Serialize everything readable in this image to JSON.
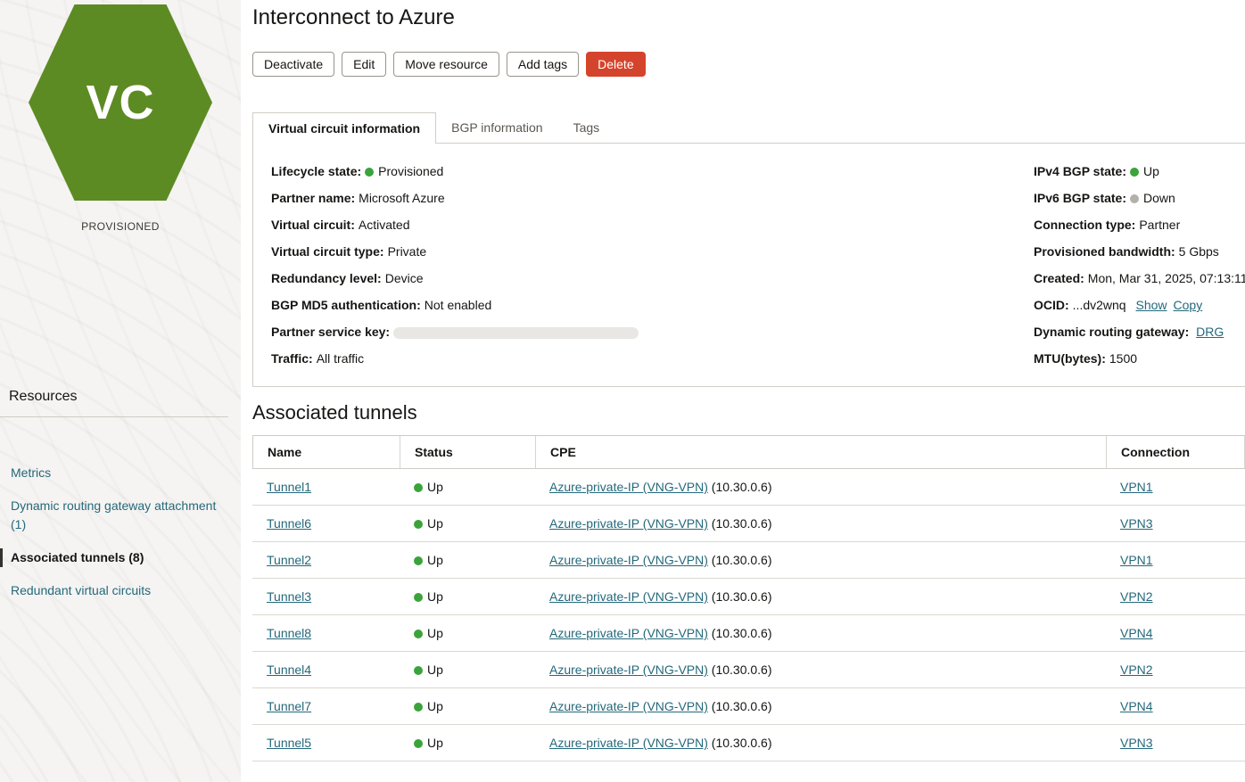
{
  "colors": {
    "link": "#24687b",
    "status_green": "#3ba33b",
    "status_gray": "#b4b0aa",
    "danger_red": "#d4442c",
    "hexagon_green": "#5d8b23"
  },
  "entity": {
    "icon_label": "VC",
    "state_caption": "PROVISIONED"
  },
  "page": {
    "title": "Interconnect to Azure"
  },
  "actions": [
    {
      "label": "Deactivate"
    },
    {
      "label": "Edit"
    },
    {
      "label": "Move resource"
    },
    {
      "label": "Add tags"
    },
    {
      "label": "Delete",
      "danger": true
    }
  ],
  "tabs": [
    {
      "label": "Virtual circuit information",
      "active": true
    },
    {
      "label": "BGP information"
    },
    {
      "label": "Tags"
    }
  ],
  "details": {
    "left": [
      {
        "label": "Lifecycle state:",
        "status": "green",
        "value": "Provisioned"
      },
      {
        "label": "Partner name:",
        "value": "Microsoft Azure"
      },
      {
        "label": "Virtual circuit:",
        "value": "Activated"
      },
      {
        "label": "Virtual circuit type:",
        "value": "Private"
      },
      {
        "label": "Redundancy level:",
        "value": "Device"
      },
      {
        "label": "BGP MD5 authentication:",
        "value": "Not enabled"
      },
      {
        "label": "Partner service key:",
        "redacted": true
      },
      {
        "label": "Traffic:",
        "value": "All traffic"
      }
    ],
    "right": [
      {
        "label": "IPv4 BGP state:",
        "status": "green",
        "value": "Up"
      },
      {
        "label": "IPv6 BGP state:",
        "status": "gray",
        "value": "Down"
      },
      {
        "label": "Connection type:",
        "value": "Partner"
      },
      {
        "label": "Provisioned bandwidth:",
        "value": "5 Gbps"
      },
      {
        "label": "Created:",
        "value": "Mon, Mar 31, 2025, 07:13:11"
      },
      {
        "label": "OCID:",
        "value": "...dv2wnq",
        "links": [
          "Show",
          "Copy"
        ]
      },
      {
        "label": "Dynamic routing gateway:",
        "link": "DRG"
      },
      {
        "label": "MTU(bytes):",
        "value": "1500"
      }
    ]
  },
  "resources": {
    "heading": "Resources",
    "items": [
      {
        "label": "Metrics"
      },
      {
        "label": "Dynamic routing gateway attachment (1)"
      },
      {
        "label": "Associated tunnels (8)",
        "active": true
      },
      {
        "label": "Redundant virtual circuits"
      }
    ]
  },
  "tunnels": {
    "heading": "Associated tunnels",
    "columns": [
      "Name",
      "Status",
      "CPE",
      "Connection"
    ],
    "rows": [
      {
        "name": "Tunnel1",
        "status": "Up",
        "status_color": "green",
        "cpe_link": "Azure-private-IP (VNG-VPN)",
        "cpe_suffix": "(10.30.0.6)",
        "connection": "VPN1"
      },
      {
        "name": "Tunnel6",
        "status": "Up",
        "status_color": "green",
        "cpe_link": "Azure-private-IP (VNG-VPN)",
        "cpe_suffix": "(10.30.0.6)",
        "connection": "VPN3"
      },
      {
        "name": "Tunnel2",
        "status": "Up",
        "status_color": "green",
        "cpe_link": "Azure-private-IP (VNG-VPN)",
        "cpe_suffix": "(10.30.0.6)",
        "connection": "VPN1"
      },
      {
        "name": "Tunnel3",
        "status": "Up",
        "status_color": "green",
        "cpe_link": "Azure-private-IP (VNG-VPN)",
        "cpe_suffix": "(10.30.0.6)",
        "connection": "VPN2"
      },
      {
        "name": "Tunnel8",
        "status": "Up",
        "status_color": "green",
        "cpe_link": "Azure-private-IP (VNG-VPN)",
        "cpe_suffix": "(10.30.0.6)",
        "connection": "VPN4"
      },
      {
        "name": "Tunnel4",
        "status": "Up",
        "status_color": "green",
        "cpe_link": "Azure-private-IP (VNG-VPN)",
        "cpe_suffix": "(10.30.0.6)",
        "connection": "VPN2"
      },
      {
        "name": "Tunnel7",
        "status": "Up",
        "status_color": "green",
        "cpe_link": "Azure-private-IP (VNG-VPN)",
        "cpe_suffix": "(10.30.0.6)",
        "connection": "VPN4"
      },
      {
        "name": "Tunnel5",
        "status": "Up",
        "status_color": "green",
        "cpe_link": "Azure-private-IP (VNG-VPN)",
        "cpe_suffix": "(10.30.0.6)",
        "connection": "VPN3"
      }
    ]
  }
}
